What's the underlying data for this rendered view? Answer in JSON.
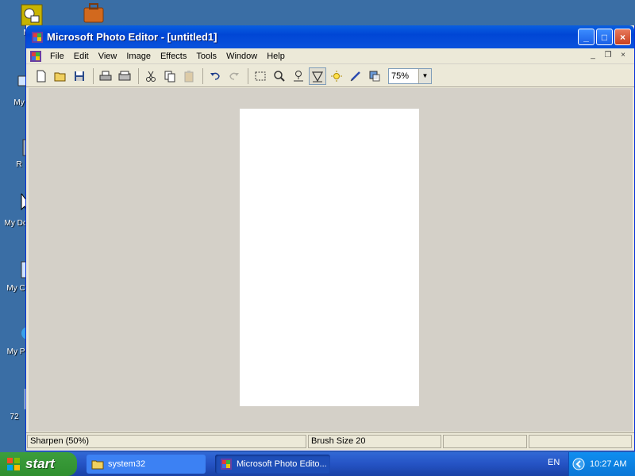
{
  "desktop": {
    "icons": [
      {
        "label": "Mi O"
      },
      {
        "label": "My"
      },
      {
        "label": "R"
      },
      {
        "label": "My Do"
      },
      {
        "label": "My C"
      },
      {
        "label": "My P"
      },
      {
        "label": "72"
      }
    ]
  },
  "window": {
    "title": "Microsoft Photo Editor - [untitled1]",
    "controls": {
      "minimize": "_",
      "maximize": "□",
      "close": "×"
    }
  },
  "menu": {
    "items": [
      "File",
      "Edit",
      "View",
      "Image",
      "Effects",
      "Tools",
      "Window",
      "Help"
    ],
    "mdi_controls": {
      "minimize": "_",
      "restore": "❐",
      "close": "×"
    }
  },
  "toolbar": {
    "zoom_value": "75%"
  },
  "statusbar": {
    "effect": "Sharpen (50%)",
    "brush": "Brush Size 20",
    "panel3": "",
    "panel4": ""
  },
  "taskbar": {
    "start_label": "start",
    "tasks": [
      {
        "label": "system32"
      },
      {
        "label": "Microsoft Photo Edito..."
      }
    ],
    "language": "EN",
    "clock": "10:27 AM"
  },
  "colors": {
    "desktop": "#3a6ea5",
    "titlebar": "#0a52dc",
    "workspace": "#d4d0c8",
    "taskbar": "#2553c4",
    "start": "#2f8f2f"
  }
}
